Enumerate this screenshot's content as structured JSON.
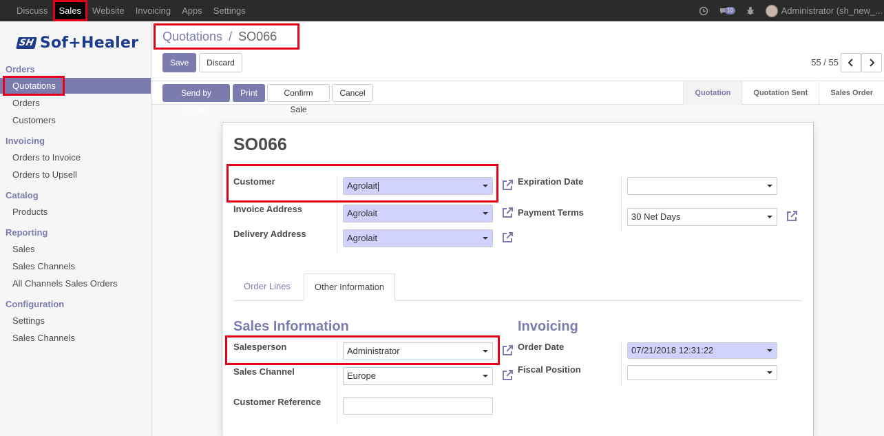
{
  "topnav": {
    "items": [
      "Discuss",
      "Sales",
      "Website",
      "Invoicing",
      "Apps",
      "Settings"
    ],
    "active": "Sales",
    "messages_badge": "10",
    "user": "Administrator (sh_new_..."
  },
  "logo": {
    "mark": "SH",
    "text": "Sof+Healer"
  },
  "sidebar": {
    "sections": [
      {
        "title": "Orders",
        "items": [
          "Quotations",
          "Orders",
          "Customers"
        ]
      },
      {
        "title": "Invoicing",
        "items": [
          "Orders to Invoice",
          "Orders to Upsell"
        ]
      },
      {
        "title": "Catalog",
        "items": [
          "Products"
        ]
      },
      {
        "title": "Reporting",
        "items": [
          "Sales",
          "Sales Channels",
          "All Channels Sales Orders"
        ]
      },
      {
        "title": "Configuration",
        "items": [
          "Settings",
          "Sales Channels"
        ]
      }
    ],
    "active": "Quotations"
  },
  "breadcrumb": {
    "parent": "Quotations",
    "separator": "/",
    "current": "SO066"
  },
  "buttons": {
    "save": "Save",
    "discard": "Discard",
    "send_email": "Send by Email",
    "print": "Print",
    "confirm": "Confirm Sale",
    "cancel": "Cancel"
  },
  "pager": {
    "value": "55 / 55",
    "prev": "‹",
    "next": "›"
  },
  "stages": [
    "Quotation",
    "Quotation Sent",
    "Sales Order"
  ],
  "current_stage": "Quotation",
  "form": {
    "name": "SO066",
    "customer_label": "Customer",
    "customer": "Agrolait",
    "invoice_address_label": "Invoice Address",
    "invoice_address": "Agrolait",
    "delivery_address_label": "Delivery Address",
    "delivery_address": "Agrolait",
    "expiration_label": "Expiration Date",
    "expiration": "",
    "payment_terms_label": "Payment Terms",
    "payment_terms": "30 Net Days",
    "tabs": [
      "Order Lines",
      "Other Information"
    ],
    "active_tab": "Other Information",
    "sales_info_title": "Sales Information",
    "salesperson_label": "Salesperson",
    "salesperson": "Administrator",
    "sales_channel_label": "Sales Channel",
    "sales_channel": "Europe",
    "customer_ref_label": "Customer Reference",
    "customer_ref": "",
    "invoicing_title": "Invoicing",
    "order_date_label": "Order Date",
    "order_date": "07/21/2018 12:31:22",
    "fiscal_position_label": "Fiscal Position",
    "fiscal_position": ""
  },
  "colors": {
    "accent": "#7c7bad",
    "highlight": "#e2001a",
    "required_field": "#d2d2ff"
  }
}
